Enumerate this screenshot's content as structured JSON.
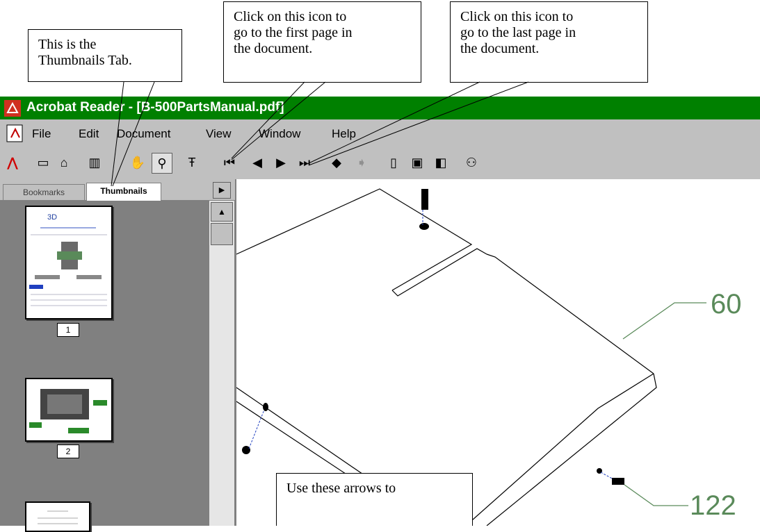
{
  "window": {
    "title": "Acrobat Reader - [B-500PartsManual.pdf]"
  },
  "menu": [
    "File",
    "Edit",
    "Document",
    "View",
    "Window",
    "Help"
  ],
  "tabs": {
    "bookmarks": "Bookmarks",
    "thumbnails": "Thumbnails"
  },
  "thumbnails": [
    {
      "page": "1"
    },
    {
      "page": "2"
    }
  ],
  "callouts": {
    "thumbnails_tab": "This is the\nThumbnails Tab.",
    "first_page": "Click on this icon to\ngo to the first page in\nthe document.",
    "last_page": "Click on this icon to\ngo to the last page in\nthe document.",
    "arrows": "Use these arrows to"
  },
  "drawing_labels": {
    "part_60": "60",
    "part_122": "122"
  },
  "icons": [
    "acrobat-logo-icon",
    "open-icon",
    "print-icon",
    "show-hide-pane-icon",
    "hand-tool-icon",
    "zoom-tool-icon",
    "text-select-icon",
    "first-page-icon",
    "previous-page-icon",
    "next-page-icon",
    "last-page-icon",
    "go-back-icon",
    "go-forward-icon",
    "actual-size-icon",
    "fit-page-icon",
    "fit-width-icon",
    "find-icon"
  ]
}
